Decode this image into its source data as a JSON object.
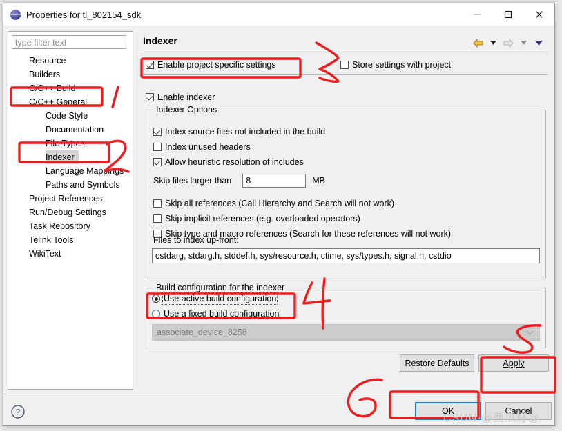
{
  "window": {
    "title": "Properties for tl_802154_sdk",
    "icon": "eclipse-sphere-icon",
    "controls": {
      "minimize": "minimize-icon",
      "maximize": "maximize-icon",
      "close": "close-icon"
    }
  },
  "sidebar": {
    "filter": {
      "placeholder": "type filter text",
      "value": ""
    },
    "items": [
      {
        "label": "Resource",
        "level": 1,
        "selected": false
      },
      {
        "label": "Builders",
        "level": 1,
        "selected": false
      },
      {
        "label": "C/C++ Build",
        "level": 1,
        "selected": false
      },
      {
        "label": "C/C++ General",
        "level": 1,
        "selected": false
      },
      {
        "label": "Code Style",
        "level": 2,
        "selected": false
      },
      {
        "label": "Documentation",
        "level": 2,
        "selected": false
      },
      {
        "label": "File Types",
        "level": 2,
        "selected": false
      },
      {
        "label": "Indexer",
        "level": 2,
        "selected": true
      },
      {
        "label": "Language Mappings",
        "level": 2,
        "selected": false
      },
      {
        "label": "Paths and Symbols",
        "level": 2,
        "selected": false
      },
      {
        "label": "Project References",
        "level": 1,
        "selected": false
      },
      {
        "label": "Run/Debug Settings",
        "level": 1,
        "selected": false
      },
      {
        "label": "Task Repository",
        "level": 1,
        "selected": false
      },
      {
        "label": "Telink Tools",
        "level": 1,
        "selected": false
      },
      {
        "label": "WikiText",
        "level": 1,
        "selected": false
      }
    ]
  },
  "page": {
    "title": "Indexer",
    "nav": {
      "back": "back-arrow-icon",
      "back_menu": "chevron-down-icon",
      "forward": "forward-arrow-icon",
      "forward_menu": "chevron-down-icon",
      "more": "chevron-down-icon"
    },
    "enable_project_specific": {
      "label": "Enable project specific settings",
      "checked": true
    },
    "store_with_project": {
      "label": "Store settings with project",
      "checked": false
    },
    "enable_indexer": {
      "label": "Enable indexer",
      "checked": true
    },
    "indexer_options": {
      "legend": "Indexer Options",
      "checkboxes": [
        {
          "label": "Index source files not included in the build",
          "checked": true
        },
        {
          "label": "Index unused headers",
          "checked": false
        },
        {
          "label": "Allow heuristic resolution of includes",
          "checked": true
        },
        {
          "label": "Skip all references (Call Hierarchy and Search will not work)",
          "checked": false
        },
        {
          "label": "Skip implicit references (e.g. overloaded operators)",
          "checked": false
        },
        {
          "label": "Skip type and macro references (Search for these references will not work)",
          "checked": false
        }
      ],
      "skip_files": {
        "label": "Skip files larger than",
        "value": "8",
        "unit": "MB"
      },
      "files_upfront": {
        "label": "Files to index up-front:",
        "value": "cstdarg, stdarg.h, stddef.h, sys/resource.h, ctime, sys/types.h, signal.h, cstdio"
      }
    },
    "build_config": {
      "legend": "Build configuration for the indexer",
      "options": [
        {
          "label": "Use active build configuration",
          "selected": true
        },
        {
          "label": "Use a fixed build configuration",
          "selected": false
        }
      ],
      "combo": {
        "value": "associate_device_8258",
        "disabled": true,
        "arrow": "chevron-down-icon"
      }
    },
    "restore_defaults_button": {
      "label": "Restore Defaults",
      "mnemonic": "D"
    },
    "apply_button": {
      "label": "Apply",
      "mnemonic": "A"
    }
  },
  "footer": {
    "help_button": "help-icon",
    "ok_button": "OK",
    "cancel_button": "Cancel"
  },
  "annotations": {
    "color": "#ee1c1c",
    "marks": [
      {
        "name": "mark-1",
        "text": "1"
      },
      {
        "name": "mark-2",
        "text": "2"
      },
      {
        "name": "mark-3",
        "text": "3"
      },
      {
        "name": "mark-4",
        "text": "4"
      },
      {
        "name": "mark-5",
        "text": "5"
      },
      {
        "name": "mark-6",
        "text": "6"
      }
    ]
  },
  "watermark": {
    "text": "CSDN @西瓜籽@"
  }
}
